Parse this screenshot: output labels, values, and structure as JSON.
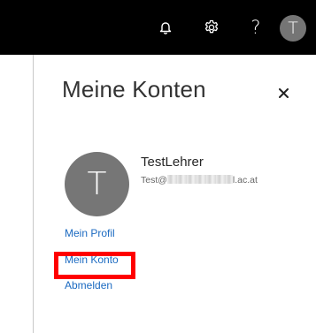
{
  "header": {
    "notifications_icon": "bell-icon",
    "settings_icon": "gear-icon",
    "help_label": "?",
    "avatar_initial": "T",
    "background_color": "#000000"
  },
  "panel": {
    "title": "Meine Konten",
    "close_label": "×",
    "user": {
      "initial": "T",
      "name": "TestLehrer",
      "email_start": "Test@",
      "email_end": "l.ac.at"
    },
    "links": [
      {
        "label": "Mein Profil"
      },
      {
        "label": "Mein Konto"
      },
      {
        "label": "Abmelden"
      }
    ],
    "link_color": "#1b6ac1",
    "highlight_color": "#ff0000"
  }
}
